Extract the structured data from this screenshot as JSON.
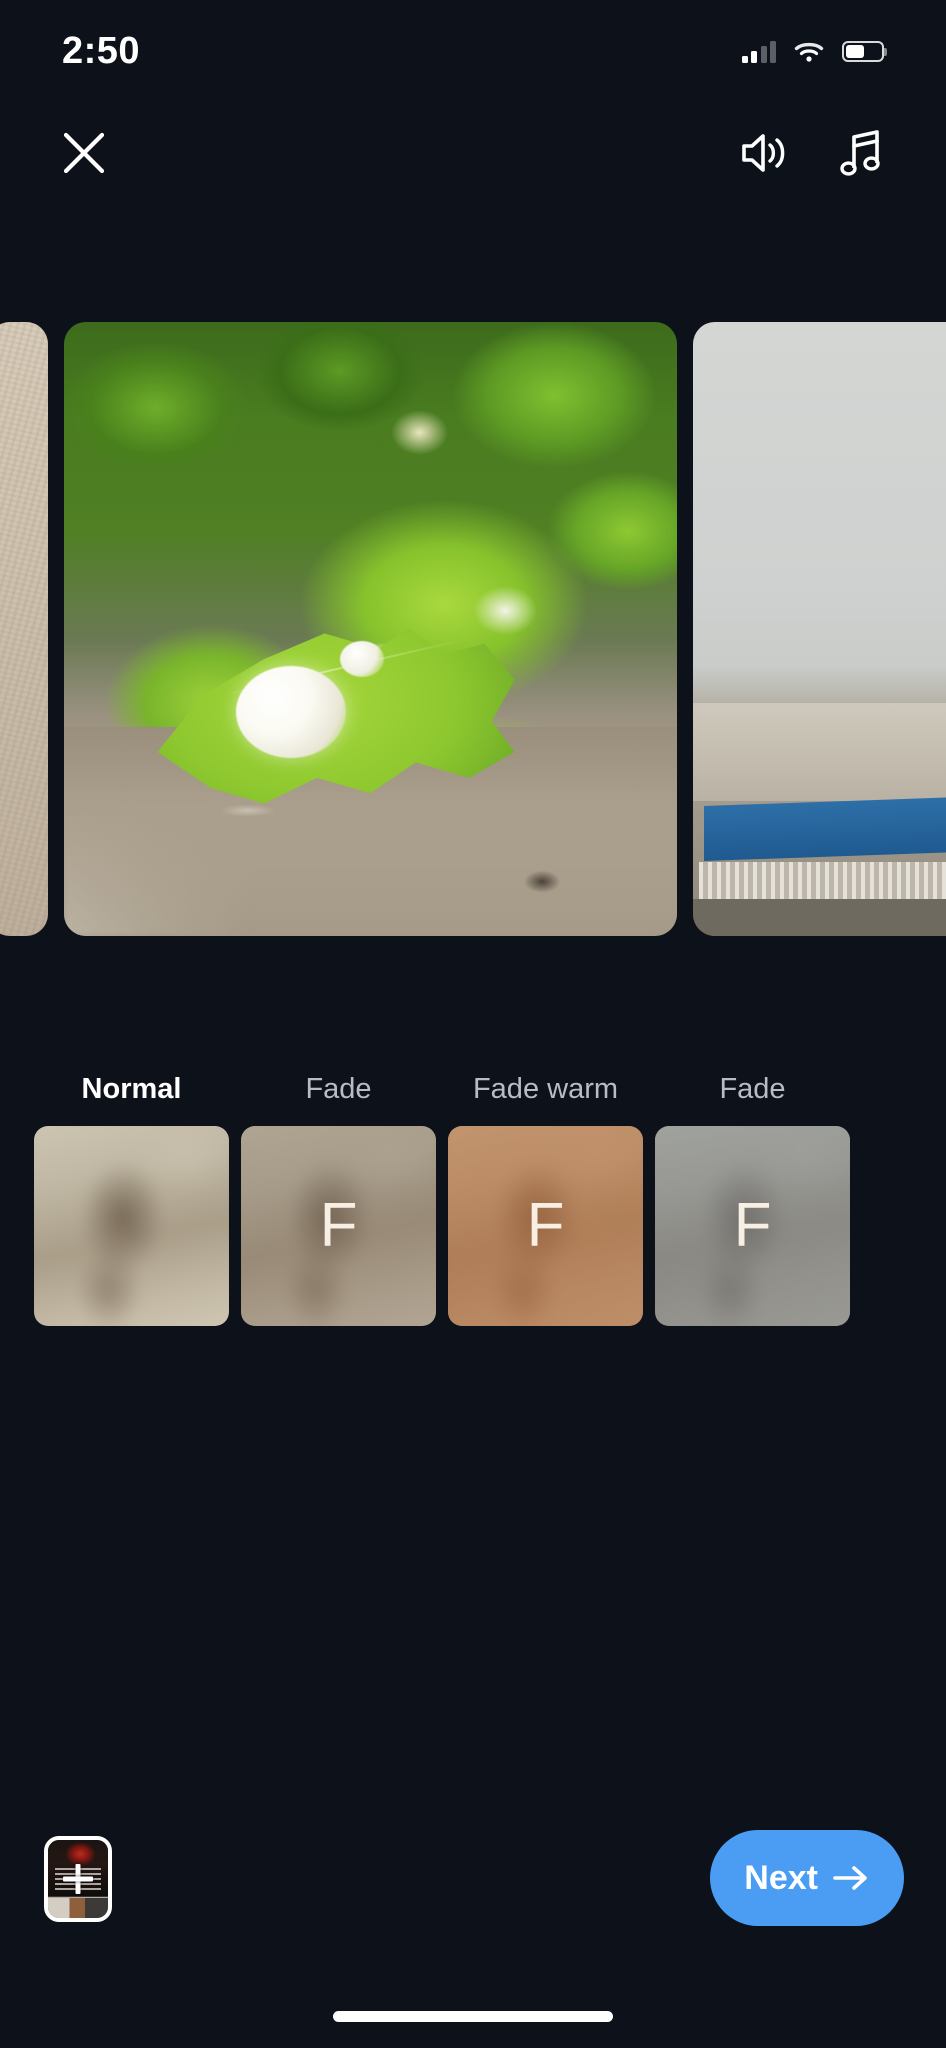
{
  "status_bar": {
    "time": "2:50",
    "cellular_icon": "cellular-signal-icon",
    "wifi_icon": "wifi-icon",
    "battery_icon": "battery-icon",
    "battery_level_percent": 52
  },
  "toolbar": {
    "close_icon": "close-icon",
    "volume_icon": "volume-speaker-icon",
    "music_icon": "music-note-icon"
  },
  "carousel": {
    "previous_slide_alt": "beige textured wall photo",
    "current_slide_alt": "jasmine flower with green leaves photo",
    "next_slide_alt": "rooftop sky and building photo"
  },
  "filters": {
    "items": [
      {
        "label": "Normal",
        "selected": true,
        "letter": "",
        "tint_hex": "#00000000"
      },
      {
        "label": "Fade",
        "selected": false,
        "letter": "F",
        "tint_hex": "#6e5c4e"
      },
      {
        "label": "Fade warm",
        "selected": false,
        "letter": "F",
        "tint_hex": "#ba6830"
      },
      {
        "label": "Fade",
        "selected": false,
        "letter": "F",
        "tint_hex": "#78828c"
      }
    ]
  },
  "bottom_bar": {
    "add_media_label": "add-media-thumbnail",
    "add_media_plus_icon": "plus-icon",
    "next_label": "Next",
    "next_arrow_icon": "arrow-right-icon",
    "next_button_color": "#4a9df2",
    "home_indicator": "home-indicator"
  },
  "theme": {
    "background_hex": "#0d111a",
    "accent_hex": "#4a9df2",
    "text_primary_hex": "#ffffff",
    "text_secondary_hex": "#b9bcc4"
  }
}
